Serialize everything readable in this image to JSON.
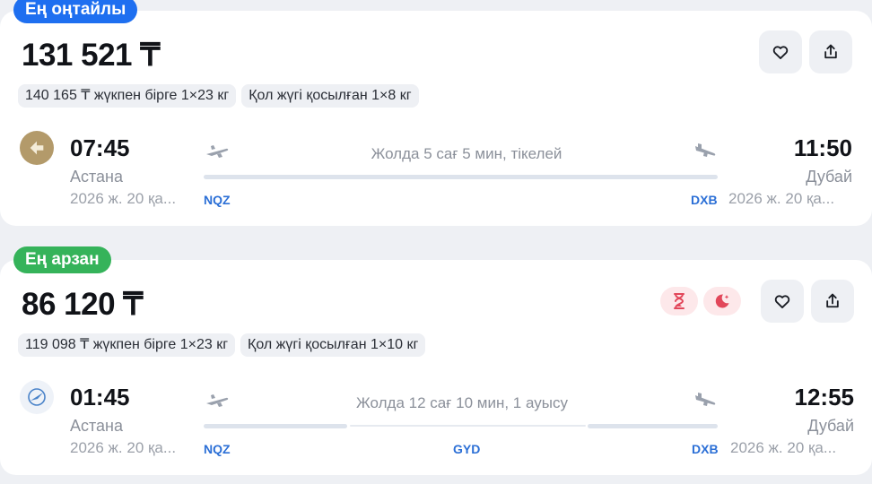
{
  "colors": {
    "accent_blue": "#1e6ff0",
    "accent_green": "#35b35a",
    "code_blue": "#2b6fd6",
    "tag_red": "#e2475a"
  },
  "offers": [
    {
      "badge": "Ең оңтайлы",
      "price": "131 521 ₸",
      "chips": [
        "140 165 ₸ жүкпен бірге 1×23 кг",
        "Қол жүгі қосылған 1×8 кг"
      ],
      "airline_icon": "air-astana-logo",
      "departure": {
        "time": "07:45",
        "city": "Астана",
        "date": "2026 ж. 20 қа...",
        "code": "NQZ"
      },
      "arrival": {
        "time": "11:50",
        "city": "Дубай",
        "date": "2026 ж. 20 қа...",
        "code": "DXB"
      },
      "duration": "Жолда 5 сағ 5 мин, тікелей",
      "actions": {
        "favorite_icon": "heart-icon",
        "share_icon": "share-icon"
      }
    },
    {
      "badge": "Ең арзан",
      "price": "86 120 ₸",
      "chips": [
        "119 098 ₸ жүкпен бірге 1×23 кг",
        "Қол жүгі қосылған 1×10 кг"
      ],
      "airline_icon": "azal-logo",
      "tags": [
        "hourglass-icon",
        "night-flight-icon"
      ],
      "departure": {
        "time": "01:45",
        "city": "Астана",
        "date": "2026 ж. 20 қа...",
        "code": "NQZ"
      },
      "arrival": {
        "time": "12:55",
        "city": "Дубай",
        "date": "2026 ж. 20 қа...",
        "code": "DXB"
      },
      "stopover_code": "GYD",
      "duration": "Жолда 12 сағ 10 мин, 1 ауысу",
      "actions": {
        "favorite_icon": "heart-icon",
        "share_icon": "share-icon"
      }
    }
  ]
}
